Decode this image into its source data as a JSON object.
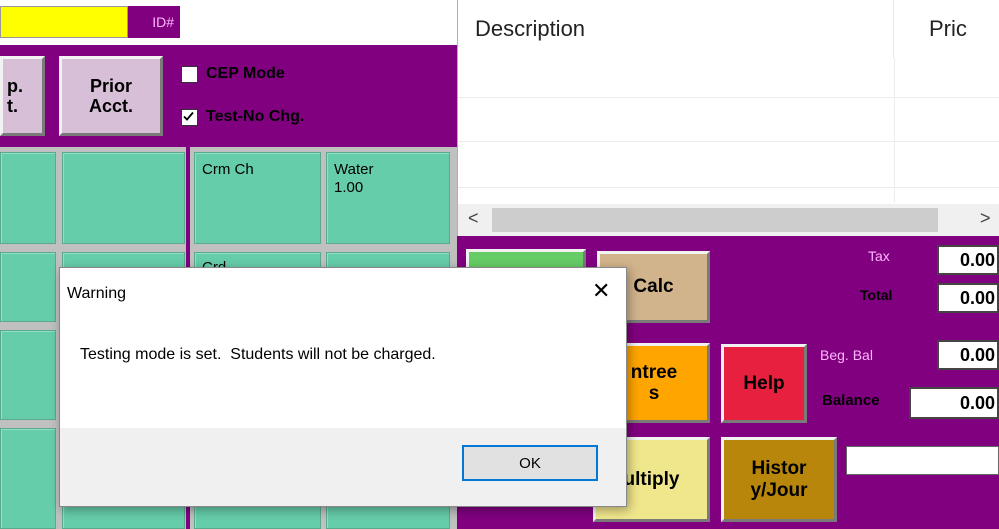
{
  "header": {
    "id_label": "ID#"
  },
  "buttons": {
    "emp_acct": "p.\nt.",
    "prior_acct": "Prior\nAcct."
  },
  "checkboxes": {
    "cep_mode": {
      "label": "CEP Mode",
      "checked": false
    },
    "test_no_chg": {
      "label": "Test-No Chg.",
      "checked": true
    }
  },
  "tiles": {
    "crm_ch": "Crm Ch",
    "water": "Water\n1.00",
    "partial": "Crd..."
  },
  "grid": {
    "col_description": "Description",
    "col_price": "Pric"
  },
  "scrollbar": {
    "left": "<",
    "right": ">"
  },
  "actions": {
    "calc": "Calc",
    "entrees": "ntree\ns",
    "help": "Help",
    "multiply": "ultiply",
    "history": "Histor\ny/Jour"
  },
  "totals": {
    "tax_label": "Tax",
    "tax_value": "0.00",
    "total_label": "Total",
    "total_value": "0.00",
    "beg_bal_label": "Beg. Bal",
    "beg_bal_value": "0.00",
    "balance_label": "Balance",
    "balance_value": "0.00"
  },
  "dialog": {
    "title": "Warning",
    "close": "✕",
    "message": "Testing mode is set.  Students will not be charged.",
    "ok": "OK"
  },
  "colors": {
    "purple": "#800080",
    "tile": "#66cdaa",
    "yellow": "#ffff00",
    "help": "#e8203f",
    "entrees": "#ffa500",
    "calc": "#d2b48c",
    "history": "#b8860b",
    "multiply": "#f0e68c"
  }
}
